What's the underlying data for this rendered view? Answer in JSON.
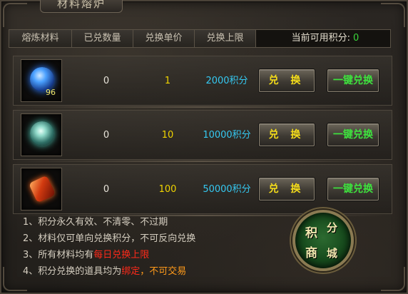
{
  "window": {
    "title": "材料熔炉"
  },
  "header": {
    "col_material": "熔炼材料",
    "col_owned": "已兑数量",
    "col_price": "兑换单价",
    "col_limit": "兑换上限",
    "points_label": "当前可用积分:",
    "points_value": "0"
  },
  "rows": [
    {
      "item_icon": "blue-orb-icon",
      "item_qty": "96",
      "owned": "0",
      "price": "1",
      "limit": "2000积分",
      "exchange_label": "兑 换",
      "onekey_label": "一键兑换"
    },
    {
      "item_icon": "teal-orb-icon",
      "item_qty": "",
      "owned": "0",
      "price": "10",
      "limit": "10000积分",
      "exchange_label": "兑 换",
      "onekey_label": "一键兑换"
    },
    {
      "item_icon": "red-gem-icon",
      "item_qty": "",
      "owned": "0",
      "price": "100",
      "limit": "50000积分",
      "exchange_label": "兑 换",
      "onekey_label": "一键兑换"
    }
  ],
  "notes": [
    {
      "text": "1、积分永久有效、不清零、不过期"
    },
    {
      "text": "2、材料仅可单向兑换积分，不可反向兑换"
    },
    {
      "prefix": "3、所有材料均有",
      "highlight": "每日兑换上限"
    },
    {
      "prefix": "4、积分兑换的道具均为",
      "highlight": "绑定",
      "suffix": "，不可交易"
    }
  ],
  "shop_button": {
    "char1": "积",
    "char2": "分",
    "char3": "商",
    "char4": "城"
  },
  "colors": {
    "points": "#3ad53a",
    "price": "#f0d400",
    "limit": "#35c9f2",
    "exchange": "#f5dd1a",
    "onekey": "#3ee23e",
    "warning": "#ff2a1a",
    "bound": "#ff9a1a"
  }
}
